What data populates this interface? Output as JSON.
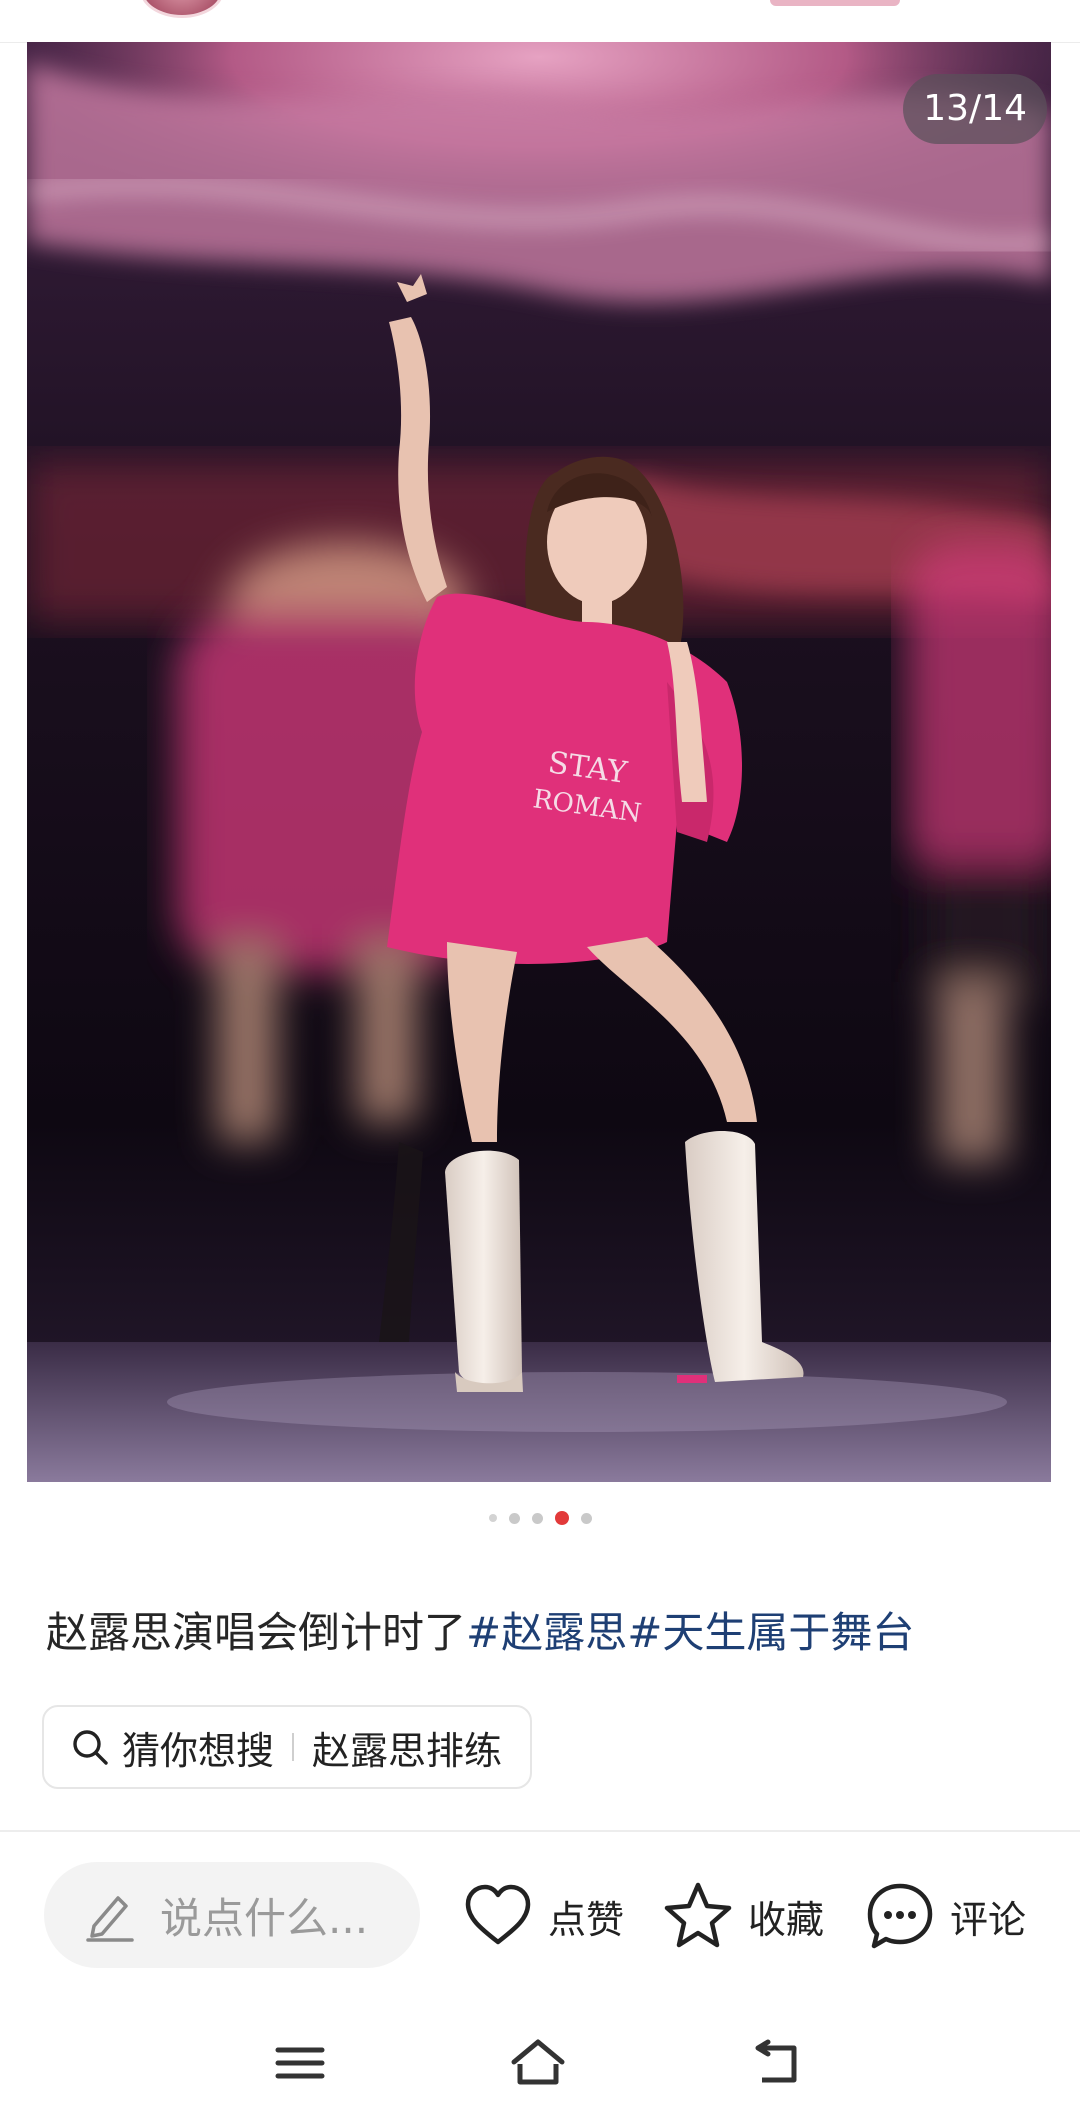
{
  "photo": {
    "counter": "13/14",
    "shirt_text": "STAY ROMAN",
    "carousel": {
      "total_dots": 5,
      "active_index": 3
    }
  },
  "post": {
    "caption_text": "赵露思演唱会倒计时了",
    "tags": [
      "#赵露思",
      "#天生属于舞台"
    ]
  },
  "search_suggest": {
    "lead": "猜你想搜",
    "query": "赵露思排练"
  },
  "action_bar": {
    "comment_placeholder": "说点什么...",
    "like_label": "点赞",
    "favorite_label": "收藏",
    "comment_label": "评论"
  },
  "icons": {
    "search": "search-icon",
    "pen": "pen-icon",
    "like": "heart-icon",
    "favorite": "star-icon",
    "comment": "chat-bubble-icon",
    "nav_menu": "menu-icon",
    "nav_home": "home-icon",
    "nav_back": "back-icon"
  },
  "colors": {
    "active_dot": "#e23a3a",
    "tag_link": "#1e3f74",
    "shirt_pink": "#e0307a"
  }
}
